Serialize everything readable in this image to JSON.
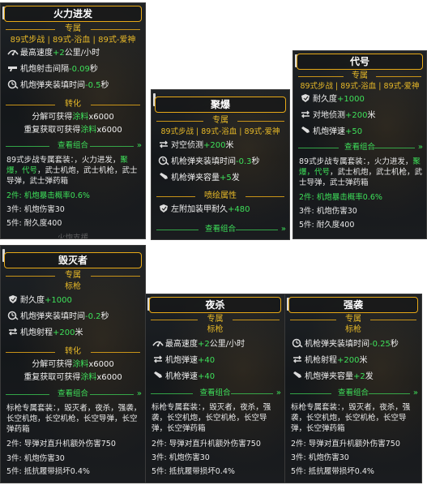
{
  "panels": {
    "p1": {
      "title": "火力进发",
      "section1": "专属",
      "vehicles": "89式步战 | 89式-浴血 | 89式-爱神",
      "stats": [
        {
          "label": "最高速度",
          "value": "+2",
          "unit": "公里/小时"
        },
        {
          "label": "机炮射击间隔",
          "value": "-0.09",
          "unit": "秒"
        },
        {
          "label": "机炮弹夹装填时间",
          "value": "-0.5",
          "unit": "秒"
        }
      ],
      "section2": "转化",
      "conv1_pre": "分解可获得",
      "conv1_hl": "涂料",
      "conv1_post": "x6000",
      "conv2_pre": "重复获取可获得",
      "conv2_hl": "涂料",
      "conv2_post": "x6000",
      "check": "查看组合",
      "set_pre": "89式步战专属套装：，火力进发，",
      "set_hl": "聚爆，代号",
      "set_post": "，武士机炮，武士机枪，武士导弹，武士弹药箱",
      "bonus2": "2件: 机炮暴击概率0.6%",
      "bonus3": "3件: 机炮伤害30",
      "bonus5": "5件: 耐久度400",
      "cut": "火炮支援"
    },
    "p2": {
      "title": "聚爆",
      "section1": "专属",
      "vehicles": "89式步战 | 89式-浴血 | 89式-爱神",
      "stats": [
        {
          "label": "对空侦测",
          "value": "+200",
          "unit": "米"
        },
        {
          "label": "机枪弹夹装填时间",
          "value": "-0.3",
          "unit": "秒"
        },
        {
          "label": "机枪弹夹容量",
          "value": "+5",
          "unit": "发"
        }
      ],
      "section2": "喷绘属性",
      "paint": {
        "label": "左附加装甲耐久",
        "value": "+480",
        "unit": ""
      },
      "check": "查看组合"
    },
    "p3": {
      "title": "代号",
      "section1": "专属",
      "vehicles": "89式步战 | 89式-浴血 | 89式-爱神",
      "stats": [
        {
          "label": "耐久度",
          "value": "+1000",
          "unit": ""
        },
        {
          "label": "对地侦测",
          "value": "+200",
          "unit": "米"
        },
        {
          "label": "机炮弹速",
          "value": "+50",
          "unit": ""
        }
      ],
      "check": "查看组合",
      "set_pre": "89式步战专属套装：，火力进发，",
      "set_hl": "聚爆，代号",
      "set_post": "，武士机炮，武士机枪，武士导弹，武士弹药箱",
      "bonus2": "2件: 机炮暴击概率0.6%",
      "bonus3": "3件: 机炮伤害30",
      "bonus5": "5件: 耐久度400"
    },
    "p4": {
      "title": "毁灭者",
      "section1": "专属",
      "vehicles": "标枪",
      "stats": [
        {
          "label": "耐久度",
          "value": "+1000",
          "unit": ""
        },
        {
          "label": "机炮弹夹装填时间",
          "value": "-0.2",
          "unit": "秒"
        },
        {
          "label": "机炮射程",
          "value": "+200",
          "unit": "米"
        }
      ],
      "section2": "转化",
      "conv1_pre": "分解可获得",
      "conv1_hl": "涂料",
      "conv1_post": "x6000",
      "conv2_pre": "重复获取可获得",
      "conv2_hl": "涂料",
      "conv2_post": "x6000",
      "check": "查看组合",
      "set": "标枪专属套装：，毁灭者，夜杀，强袭，长空机炮，长空机枪，长空导弹，长空弹药箱",
      "bonus2": "2件: 导弹对直升机额外伤害750",
      "bonus3": "3件: 机炮伤害30",
      "bonus5": "5件: 抵抗履带损坏0.4%"
    },
    "p5": {
      "title": "夜杀",
      "section1": "专属",
      "vehicles": "标枪",
      "stats": [
        {
          "label": "最高速度",
          "value": "+2",
          "unit": "公里/小时"
        },
        {
          "label": "机炮弹速",
          "value": "+40",
          "unit": ""
        },
        {
          "label": "机枪弹速",
          "value": "+40",
          "unit": ""
        }
      ],
      "check": "查看组合",
      "set": "标枪专属套装：，毁灭者，夜杀，强袭，长空机炮，长空机枪，长空导弹，长空弹药箱",
      "bonus2": "2件: 导弹对直升机额外伤害750",
      "bonus3": "3件: 机炮伤害30",
      "bonus5": "5件: 抵抗履带损坏0.4%"
    },
    "p6": {
      "title": "强袭",
      "section1": "专属",
      "vehicles": "标枪",
      "stats": [
        {
          "label": "机枪弹夹装填时间",
          "value": "-0.25",
          "unit": "秒"
        },
        {
          "label": "机枪射程",
          "value": "+200",
          "unit": "米"
        },
        {
          "label": "机炮弹夹容量",
          "value": "+2",
          "unit": "发"
        }
      ],
      "check": "查看组合",
      "set": "标枪专属套装：，毁灭者，夜杀，强袭，长空机炮，长空机枪，长空导弹，长空弹药箱",
      "bonus2": "2件: 导弹对直升机额外伤害750",
      "bonus3": "3件: 机炮伤害30",
      "bonus5": "5件: 抵抗履带损坏0.4%"
    }
  },
  "colors": {
    "accent": "#e6a817",
    "positive": "#3ee05a",
    "gold_text": "#e6b828"
  }
}
